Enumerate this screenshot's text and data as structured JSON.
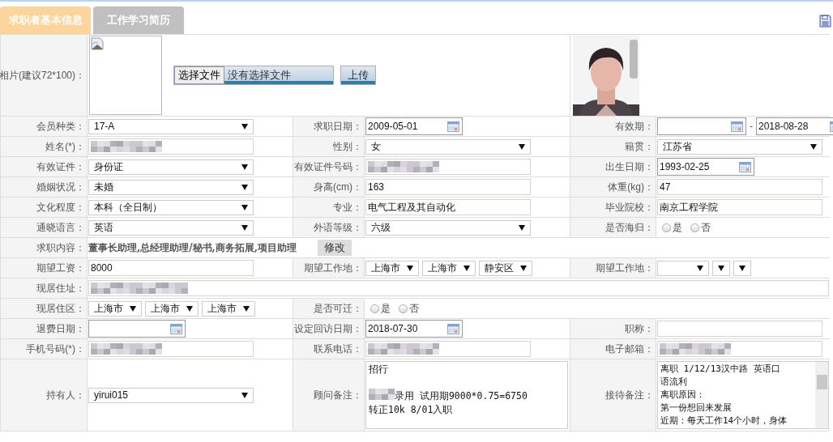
{
  "tabs": [
    {
      "label": "求职者基本信息",
      "selected": true
    },
    {
      "label": "工作学习简历",
      "selected": false
    }
  ],
  "photo_row": {
    "label": "相片(建议72*100)：",
    "file_button": "选择文件",
    "file_status": "没有选择文件",
    "upload_button": "上传"
  },
  "rows": [
    {
      "cells": [
        {
          "label": "会员种类：",
          "field": {
            "kind": "select",
            "value": "17-A"
          }
        },
        {
          "label": "求职日期：",
          "field": {
            "kind": "date",
            "value": "2009-05-01"
          }
        },
        {
          "label": "有效期：",
          "field": {
            "kind": "date_range",
            "to": "2018-08-28",
            "separator": "-"
          }
        }
      ]
    },
    {
      "cells": [
        {
          "label": "姓名(*)：",
          "field": {
            "kind": "redacted"
          }
        },
        {
          "label": "性别：",
          "field": {
            "kind": "select",
            "value": "女"
          }
        },
        {
          "label": "籍贯：",
          "field": {
            "kind": "select",
            "value": "江苏省"
          }
        }
      ]
    },
    {
      "cells": [
        {
          "label": "有效证件：",
          "field": {
            "kind": "select",
            "value": "身份证"
          }
        },
        {
          "label": "有效证件号码：",
          "field": {
            "kind": "redacted"
          }
        },
        {
          "label": "出生日期：",
          "field": {
            "kind": "date",
            "value": "1993-02-25"
          }
        }
      ]
    },
    {
      "cells": [
        {
          "label": "婚姻状况：",
          "field": {
            "kind": "select",
            "value": "未婚"
          }
        },
        {
          "label": "身高(cm)：",
          "field": {
            "kind": "input",
            "value": "163"
          }
        },
        {
          "label": "体重(kg)：",
          "field": {
            "kind": "input",
            "value": "47"
          }
        }
      ]
    },
    {
      "cells": [
        {
          "label": "文化程度：",
          "field": {
            "kind": "select",
            "value": "本科（全日制）"
          }
        },
        {
          "label": "专业：",
          "field": {
            "kind": "input",
            "value": "电气工程及其自动化"
          }
        },
        {
          "label": "毕业院校：",
          "field": {
            "kind": "input",
            "value": "南京工程学院"
          }
        }
      ]
    },
    {
      "cells": [
        {
          "label": "通晓语言：",
          "field": {
            "kind": "select",
            "value": "英语"
          }
        },
        {
          "label": "外语等级：",
          "field": {
            "kind": "select",
            "value": "六级"
          }
        },
        {
          "label": "是否海归：",
          "field": {
            "kind": "radio",
            "options": [
              {
                "label": "是",
                "selected": false
              },
              {
                "label": "否",
                "selected": false
              }
            ]
          }
        }
      ]
    },
    {
      "cells": [
        {
          "label": "求职内容：",
          "field": {
            "kind": "job_content",
            "text": "董事长助理,总经理助理/秘书,商务拓展,项目助理",
            "button": "修改"
          }
        }
      ]
    },
    {
      "cells": [
        {
          "label": "期望工资：",
          "field": {
            "kind": "input",
            "value": "8000"
          }
        },
        {
          "label": "期望工作地：",
          "field": {
            "kind": "selects",
            "values": [
              "上海市",
              "上海市",
              "静安区"
            ]
          }
        },
        {
          "label": "期望工作地：",
          "field": {
            "kind": "blank_selects"
          }
        }
      ]
    },
    {
      "cells": [
        {
          "label": "现居住址：",
          "field": {
            "kind": "redacted"
          }
        }
      ]
    },
    {
      "cells": [
        {
          "label": "现居住区：",
          "field": {
            "kind": "selects",
            "values": [
              "上海市",
              "上海市",
              "上海市"
            ]
          }
        },
        {
          "label": "是否可迁：",
          "field": {
            "kind": "radio",
            "options": [
              {
                "label": "是",
                "selected": false
              },
              {
                "label": "否",
                "selected": false
              }
            ]
          }
        }
      ]
    },
    {
      "cells": [
        {
          "label": "退费日期：",
          "field": {
            "kind": "date"
          }
        },
        {
          "label": "设定回访日期：",
          "field": {
            "kind": "date",
            "value": "2018-07-30"
          }
        },
        {
          "label": "职称：",
          "field": {
            "kind": "input"
          }
        }
      ]
    },
    {
      "cells": [
        {
          "label": "手机号码(*)：",
          "field": {
            "kind": "redacted"
          }
        },
        {
          "label": "联系电话：",
          "field": {
            "kind": "redacted"
          }
        },
        {
          "label": "电子邮箱：",
          "field": {
            "kind": "redacted"
          }
        }
      ]
    },
    {
      "cells": [
        {
          "label": "持有人：",
          "field": {
            "kind": "select",
            "value": "yirui015"
          }
        },
        {
          "label": "顾问备注：",
          "field": {
            "kind": "textarea",
            "lines": [
              {
                "kind": "text",
                "text": "招行"
              },
              {
                "kind": "blank"
              },
              {
                "kind": "text",
                "text": "录用 试用期9000*0.75=6750",
                "redacted_prefix": true
              },
              {
                "kind": "text",
                "text": "转正10k  8/01入职"
              }
            ]
          }
        },
        {
          "label": "接待备注：",
          "field": {
            "kind": "textarea",
            "scrollbar": true,
            "lines": [
              {
                "kind": "text",
                "text": "离职 1/12/13汉中路  英语口"
              },
              {
                "kind": "text",
                "text": "语流利"
              },
              {
                "kind": "text",
                "text": "离职原因："
              },
              {
                "kind": "text",
                "text": "第一份想回来发展"
              },
              {
                "kind": "text",
                "text": "近期：每天工作14个小时，身体"
              }
            ]
          }
        }
      ]
    }
  ]
}
